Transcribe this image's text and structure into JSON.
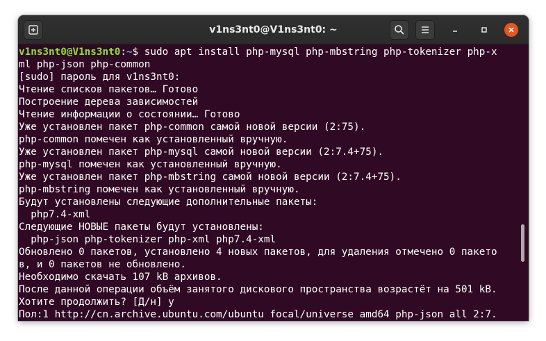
{
  "window": {
    "title": "v1ns3nt0@V1ns3nt0: ~"
  },
  "colors": {
    "terminal_bg": "#300a24",
    "titlebar_bg": "#2d2d2d",
    "prompt_user": "#8ae234",
    "prompt_path": "#729fcf",
    "close_button": "#e95420"
  },
  "icons": {
    "new_tab": "new-tab-icon",
    "search": "search-icon",
    "menu": "hamburger-menu-icon",
    "minimize": "minimize-icon",
    "maximize": "maximize-icon",
    "close": "close-icon"
  },
  "terminal": {
    "prompt_user": "v1ns3nt0@V1ns3nt0",
    "prompt_sep": ":",
    "prompt_path": "~",
    "prompt_symbol": "$",
    "command_line1": " sudo apt install php-mysql php-mbstring php-tokenizer php-x",
    "command_line2": "ml php-json php-common",
    "output": [
      "[sudo] пароль для v1ns3nt0:",
      "Чтение списков пакетов… Готово",
      "Построение дерева зависимостей",
      "Чтение информации о состоянии… Готово",
      "Уже установлен пакет php-common самой новой версии (2:75).",
      "php-common помечен как установленный вручную.",
      "Уже установлен пакет php-mysql самой новой версии (2:7.4+75).",
      "php-mysql помечен как установленный вручную.",
      "Уже установлен пакет php-mbstring самой новой версии (2:7.4+75).",
      "php-mbstring помечен как установленный вручную.",
      "Будут установлены следующие дополнительные пакеты:",
      "  php7.4-xml",
      "Следующие НОВЫЕ пакеты будут установлены:",
      "  php-json php-tokenizer php-xml php7.4-xml",
      "Обновлено 0 пакетов, установлено 4 новых пакетов, для удаления отмечено 0 пакето",
      "в, и 0 пакетов не обновлено.",
      "Необходимо скачать 107 kB архивов.",
      "После данной операции объём занятого дискового пространства возрастёт на 501 kB.",
      "Хотите продолжить? [Д/н] у",
      "Пол:1 http://cn.archive.ubuntu.com/ubuntu focal/universe amd64 php-json all 2:7."
    ]
  }
}
